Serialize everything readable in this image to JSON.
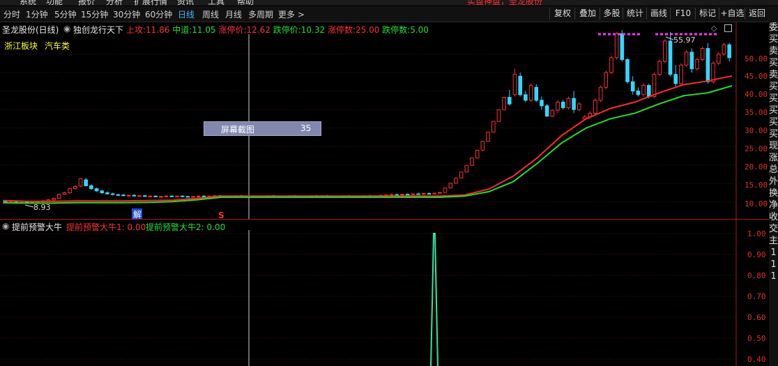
{
  "menubar": {
    "items": [
      "系统",
      "功能",
      "报价",
      "分析",
      "扩展行情",
      "资讯",
      "工具",
      "帮助"
    ],
    "notice": "实盘神盘，圣龙股份"
  },
  "toolbar": {
    "periods": [
      "分时",
      "1分钟",
      "5分钟",
      "15分钟",
      "30分钟",
      "60分钟",
      "日线",
      "周线",
      "月线",
      "多周期",
      "更多 >"
    ],
    "active_period": "日线",
    "right_buttons": [
      "复权",
      "叠加",
      "多股",
      "统计",
      "画线",
      "F10",
      "标记",
      "+自选",
      "返回"
    ]
  },
  "main_panel": {
    "stock_name": "圣龙股份(日线)",
    "indicator_name": "独创龙行天下",
    "stats": [
      {
        "label": "上攻:",
        "value": "11.86",
        "color": "#ff3030"
      },
      {
        "label": "中道:",
        "value": "11.05",
        "color": "#20e030"
      },
      {
        "label": "涨停价:",
        "value": "12.62",
        "color": "#ff3030"
      },
      {
        "label": "跌停价:",
        "value": "10.32",
        "color": "#20e030"
      },
      {
        "label": "涨停数:",
        "value": "25.00",
        "color": "#ff3030"
      },
      {
        "label": "跌停数:",
        "value": "5.00",
        "color": "#20e030"
      }
    ],
    "tags": [
      "浙江板块",
      "汽车类"
    ],
    "y_axis_labels": [
      "50.00",
      "45.00",
      "40.00",
      "35.00",
      "30.00",
      "25.00",
      "20.00",
      "15.00",
      "10.00"
    ],
    "high_label": "55.97",
    "low_label": "8.93",
    "marker_jie": "解",
    "marker_s": "S",
    "popup": {
      "label": "屏幕截图",
      "value": "35"
    }
  },
  "sub_panel": {
    "name": "提前预警大牛",
    "line1_label": "提前预警大牛1: 0.00",
    "line2_label": "提前预警大牛2: 0.00",
    "y_axis_labels": [
      "1.00",
      "0.90",
      "0.80",
      "0.70",
      "0.60",
      "0.50",
      "0.40"
    ]
  },
  "sidebar": {
    "chars": [
      "委",
      "买",
      "卖",
      "买",
      "卖",
      "买",
      "买",
      "买",
      "买",
      "买",
      "现",
      "涨",
      "总",
      "外",
      "换",
      "净",
      "收",
      "交",
      "主",
      "1",
      "1",
      "1"
    ]
  },
  "colors": {
    "red_line": "#ff2a2a",
    "green_line": "#22e022",
    "cyan": "#33d6ff",
    "active": "#3fb8ff"
  },
  "chart_data": {
    "type": "candlestick",
    "y_axis_range": [
      6,
      58
    ],
    "ma_red": [
      10.4,
      10.2,
      10.2,
      10.3,
      10.3,
      10.3,
      10.4,
      10.5,
      11,
      11.6,
      11.6,
      11.6,
      11.6,
      11.6,
      11.6,
      11.6,
      11.6,
      11.6,
      11.6,
      11.9,
      13.5,
      17,
      22,
      28,
      32.5,
      35.3,
      37,
      39.5,
      41.7,
      42.7,
      44.1
    ],
    "ma_green": [
      9.8,
      9.7,
      9.7,
      9.8,
      9.8,
      9.8,
      9.9,
      10.1,
      10.6,
      11.3,
      11.3,
      11.3,
      11.3,
      11.3,
      11.3,
      11.3,
      11.3,
      11.3,
      11.3,
      11.6,
      12.8,
      15.5,
      20.5,
      26,
      30,
      32.5,
      34,
      36.5,
      38.7,
      39.5,
      41.4
    ],
    "candles": [
      [
        10.2,
        10.6,
        9.8,
        10.0
      ],
      [
        9.9,
        10.2,
        9.6,
        10.0
      ],
      [
        10.0,
        10.3,
        9.7,
        9.8
      ],
      [
        9.8,
        10.1,
        9.6,
        9.9
      ],
      [
        10.0,
        10.2,
        9.7,
        9.8
      ],
      [
        9.8,
        10.1,
        9.6,
        10.0
      ],
      [
        10.0,
        10.4,
        9.8,
        10.2
      ],
      [
        10.1,
        10.5,
        9.9,
        10.3
      ],
      [
        10.3,
        10.8,
        10.1,
        10.6
      ],
      [
        10.6,
        11.2,
        10.4,
        11.0
      ],
      [
        11.0,
        12.3,
        10.9,
        12.1
      ],
      [
        12.1,
        12.8,
        11.9,
        12.5
      ],
      [
        12.5,
        13.8,
        12.3,
        13.6
      ],
      [
        13.6,
        14.6,
        13.4,
        14.2
      ],
      [
        14.3,
        16.5,
        14.0,
        16.3
      ],
      [
        16.0,
        16.5,
        14.2,
        14.4
      ],
      [
        14.4,
        14.8,
        13.3,
        13.6
      ],
      [
        13.6,
        13.9,
        12.8,
        13.0
      ],
      [
        13.0,
        13.3,
        12.2,
        12.5
      ],
      [
        12.5,
        12.9,
        12.0,
        12.2
      ],
      [
        12.2,
        12.5,
        11.8,
        12.0
      ],
      [
        12.0,
        12.2,
        11.6,
        11.8
      ],
      [
        11.9,
        12.1,
        11.6,
        11.7
      ],
      [
        11.7,
        12.0,
        11.5,
        11.8
      ],
      [
        11.8,
        12.1,
        11.5,
        11.6
      ],
      [
        11.6,
        11.9,
        11.4,
        11.7
      ],
      [
        11.7,
        11.9,
        11.4,
        11.5
      ],
      [
        11.5,
        11.8,
        11.3,
        11.6
      ],
      [
        11.6,
        11.8,
        11.3,
        11.4
      ],
      [
        11.4,
        11.7,
        11.2,
        11.5
      ],
      [
        11.5,
        11.8,
        11.3,
        11.6
      ],
      [
        11.6,
        11.8,
        11.4,
        11.5
      ],
      [
        11.5,
        11.7,
        11.3,
        11.6
      ],
      [
        11.6,
        11.8,
        11.4,
        11.5
      ],
      [
        11.5,
        11.7,
        11.3,
        11.4
      ],
      [
        11.4,
        11.6,
        11.2,
        11.5
      ],
      [
        11.5,
        11.7,
        11.3,
        11.6
      ],
      [
        11.6,
        11.8,
        11.4,
        11.5
      ],
      [
        11.5,
        11.7,
        11.3,
        11.6
      ],
      [
        11.6,
        11.8,
        11.4,
        11.7
      ],
      [
        11.7,
        11.9,
        11.5,
        11.6
      ],
      [
        11.6,
        11.8,
        11.4,
        11.5
      ],
      [
        11.5,
        11.7,
        11.3,
        11.6
      ],
      [
        11.6,
        11.8,
        11.4,
        11.7
      ],
      [
        11.7,
        11.9,
        11.5,
        11.6
      ],
      [
        11.6,
        11.8,
        11.4,
        11.5
      ],
      [
        11.5,
        11.7,
        11.3,
        11.6
      ],
      [
        11.6,
        11.8,
        11.4,
        11.5
      ],
      [
        11.5,
        11.7,
        11.3,
        11.6
      ],
      [
        11.6,
        11.8,
        11.4,
        11.7
      ],
      [
        11.7,
        11.9,
        11.5,
        11.6
      ],
      [
        11.6,
        11.8,
        11.4,
        11.5
      ],
      [
        11.5,
        11.7,
        11.3,
        11.6
      ],
      [
        11.6,
        11.8,
        11.4,
        11.7
      ],
      [
        11.7,
        11.9,
        11.5,
        11.6
      ],
      [
        11.6,
        11.8,
        11.4,
        11.5
      ],
      [
        11.5,
        11.7,
        11.3,
        11.6
      ],
      [
        11.6,
        11.8,
        11.4,
        11.7
      ],
      [
        11.7,
        11.9,
        11.5,
        11.6
      ],
      [
        11.6,
        11.8,
        11.4,
        11.7
      ],
      [
        11.7,
        11.9,
        11.5,
        11.6
      ],
      [
        11.6,
        11.8,
        11.4,
        11.5
      ],
      [
        11.5,
        11.7,
        11.3,
        11.6
      ],
      [
        11.6,
        11.8,
        11.4,
        11.7
      ],
      [
        11.7,
        11.9,
        11.5,
        11.6
      ],
      [
        11.6,
        11.8,
        11.4,
        11.5
      ],
      [
        11.5,
        11.7,
        11.3,
        11.6
      ],
      [
        11.6,
        11.8,
        11.4,
        11.7
      ],
      [
        11.7,
        11.9,
        11.5,
        11.6
      ],
      [
        11.6,
        11.8,
        11.4,
        11.7
      ],
      [
        11.7,
        12.0,
        11.5,
        11.8
      ],
      [
        11.8,
        12.1,
        11.6,
        11.9
      ],
      [
        11.9,
        12.2,
        11.7,
        12.0
      ],
      [
        12.0,
        12.3,
        11.8,
        11.9
      ],
      [
        11.9,
        12.2,
        11.7,
        12.1
      ],
      [
        12.1,
        12.3,
        11.9,
        12.0
      ],
      [
        12.0,
        12.3,
        11.8,
        12.2
      ],
      [
        12.2,
        12.5,
        12.0,
        12.1
      ],
      [
        12.1,
        12.4,
        11.9,
        12.3
      ],
      [
        12.3,
        12.6,
        12.1,
        12.2
      ],
      [
        12.2,
        12.5,
        12.0,
        12.4
      ],
      [
        12.4,
        12.7,
        12.2,
        12.6
      ],
      [
        12.6,
        13.9,
        12.5,
        13.8
      ],
      [
        13.8,
        15.2,
        13.7,
        15.1
      ],
      [
        15.1,
        16.6,
        15.0,
        16.5
      ],
      [
        16.5,
        18.2,
        16.4,
        18.1
      ],
      [
        18.1,
        20.0,
        18.0,
        19.9
      ],
      [
        19.9,
        22.0,
        19.8,
        21.9
      ],
      [
        21.9,
        24.1,
        21.8,
        24.0
      ],
      [
        24.0,
        26.5,
        23.9,
        26.4
      ],
      [
        26.4,
        29.0,
        26.3,
        28.9
      ],
      [
        28.9,
        31.9,
        28.8,
        31.8
      ],
      [
        31.8,
        35.0,
        31.7,
        34.9
      ],
      [
        34.9,
        38.4,
        34.8,
        38.3
      ],
      [
        38.3,
        40.3,
        36.0,
        36.5
      ],
      [
        39.0,
        46.0,
        38.5,
        44.5
      ],
      [
        44.0,
        45.0,
        38.5,
        39.0
      ],
      [
        39.0,
        40.0,
        37.0,
        37.5
      ],
      [
        37.5,
        42.0,
        37.0,
        41.5
      ],
      [
        41.0,
        41.8,
        37.0,
        37.5
      ],
      [
        37.5,
        38.5,
        35.0,
        36.0
      ],
      [
        36.0,
        36.5,
        33.0,
        33.2
      ],
      [
        33.2,
        35.0,
        33.0,
        34.8
      ],
      [
        34.8,
        37.5,
        34.0,
        37.0
      ],
      [
        37.0,
        37.6,
        35.0,
        35.5
      ],
      [
        35.5,
        38.5,
        35.0,
        38.0
      ],
      [
        38.0,
        40.0,
        34.0,
        35.0
      ],
      [
        35.0,
        37.0,
        34.5,
        36.5
      ],
      [
        32.5,
        33.5,
        32.0,
        33.0
      ],
      [
        33.0,
        34.5,
        32.5,
        34.0
      ],
      [
        34.0,
        38.0,
        33.5,
        37.5
      ],
      [
        37.5,
        41.5,
        37.0,
        41.0
      ],
      [
        41.0,
        45.5,
        40.5,
        45.0
      ],
      [
        45.0,
        49.5,
        44.5,
        49.0
      ],
      [
        49.0,
        56.0,
        48.5,
        55.5
      ],
      [
        55.5,
        56.5,
        48.0,
        48.5
      ],
      [
        48.5,
        48.8,
        42.0,
        42.5
      ],
      [
        42.5,
        44.0,
        39.0,
        40.0
      ],
      [
        40.0,
        41.0,
        38.5,
        39.0
      ],
      [
        39.0,
        42.0,
        38.5,
        41.5
      ],
      [
        41.5,
        42.0,
        38.0,
        38.5
      ],
      [
        38.5,
        45.0,
        38.0,
        44.5
      ],
      [
        44.5,
        48.5,
        44.0,
        48.0
      ],
      [
        48.0,
        54.0,
        47.5,
        53.5
      ],
      [
        53.5,
        56.0,
        44.0,
        44.5
      ],
      [
        44.5,
        47.0,
        41.0,
        42.0
      ],
      [
        42.0,
        47.5,
        41.5,
        47.0
      ],
      [
        47.0,
        51.0,
        46.5,
        50.5
      ],
      [
        50.5,
        51.5,
        45.0,
        46.0
      ],
      [
        46.0,
        49.0,
        45.5,
        48.5
      ],
      [
        48.5,
        52.0,
        48.0,
        51.5
      ],
      [
        51.5,
        53.0,
        42.0,
        42.5
      ],
      [
        42.5,
        48.0,
        42.0,
        47.5
      ],
      [
        47.5,
        50.5,
        47.0,
        50.0
      ],
      [
        50.0,
        53.0,
        49.5,
        52.5
      ],
      [
        52.5,
        53.0,
        48.0,
        49.0
      ]
    ]
  }
}
